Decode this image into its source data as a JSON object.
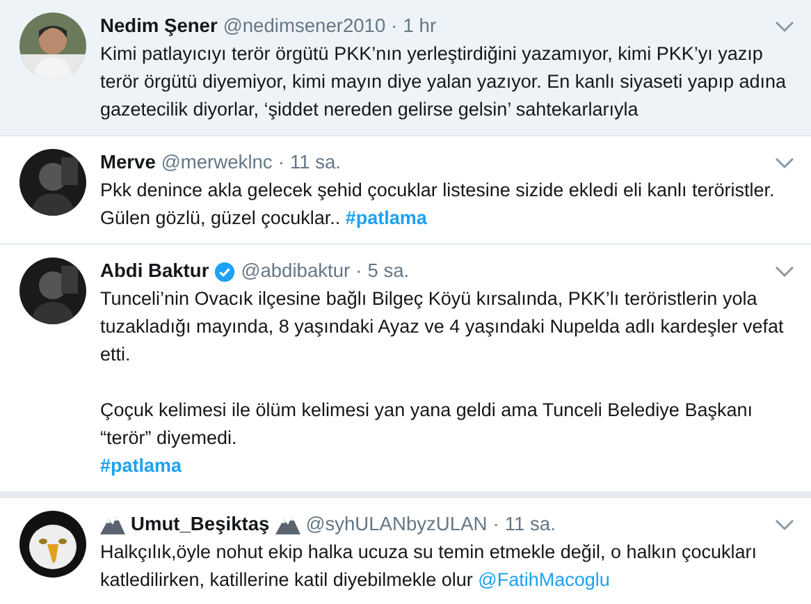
{
  "tweets": [
    {
      "name": "Nedim Şener",
      "handle": "@nedimsener2010",
      "separator": "·",
      "time": "1 hr",
      "verified": false,
      "name_emblems": false,
      "highlighted": true,
      "paragraphs": [
        [
          [
            {
              "kind": "text",
              "text": "Kimi patlayıcıyı terör örgütü PKK’nın yerleştirdiğini yazamıyor, kimi PKK’yı yazıp terör örgütü diyemiyor, kimi mayın diye yalan yazıyor. En kanlı siyaseti yapıp adına gazetecilik diyorlar, ‘şiddet nereden gelirse gelsin’ sahtekarlarıyla"
            }
          ]
        ]
      ]
    },
    {
      "name": "Merve",
      "handle": "@merweklnc",
      "separator": "·",
      "time": "11 sa.",
      "verified": false,
      "name_emblems": false,
      "highlighted": false,
      "paragraphs": [
        [
          [
            {
              "kind": "text",
              "text": "Pkk denince akla gelecek şehid çocuklar listesine sizide ekledi eli kanlı teröristler. Gülen gözlü, güzel çocuklar.. "
            },
            {
              "kind": "hashtag",
              "text": "#patlama"
            }
          ]
        ]
      ]
    },
    {
      "name": "Abdi Baktur",
      "handle": "@abdibaktur",
      "separator": "·",
      "time": "5 sa.",
      "verified": true,
      "name_emblems": false,
      "highlighted": false,
      "paragraphs": [
        [
          [
            {
              "kind": "text",
              "text": "Tunceli’nin Ovacık ilçesine bağlı Bilgeç Köyü kırsalında, PKK’lı teröristlerin yola tuzakladığı mayında, 8 yaşındaki Ayaz ve 4 yaşındaki Nupelda adlı kardeşler vefat etti."
            }
          ]
        ],
        [
          [
            {
              "kind": "text",
              "text": "Çoçuk kelimesi ile ölüm kelimesi yan yana geldi ama Tunceli Belediye Başkanı “terör” diyemedi."
            }
          ],
          [
            {
              "kind": "hashtag",
              "text": "#patlama"
            }
          ]
        ]
      ]
    },
    {
      "name": "Umut_Beşiktaş",
      "handle": "@syhULANbyzULAN",
      "separator": "·",
      "time": "11 sa.",
      "verified": false,
      "name_emblems": true,
      "highlighted": false,
      "paragraphs": [
        [
          [
            {
              "kind": "text",
              "text": "Halkçılık,öyle nohut ekip halka ucuza su temin etmekle değil, o halkın çocukları katledilirken, katillerine katil diyebilmekle olur "
            },
            {
              "kind": "mention",
              "text": "@FatihMacoglu"
            }
          ]
        ]
      ]
    }
  ]
}
